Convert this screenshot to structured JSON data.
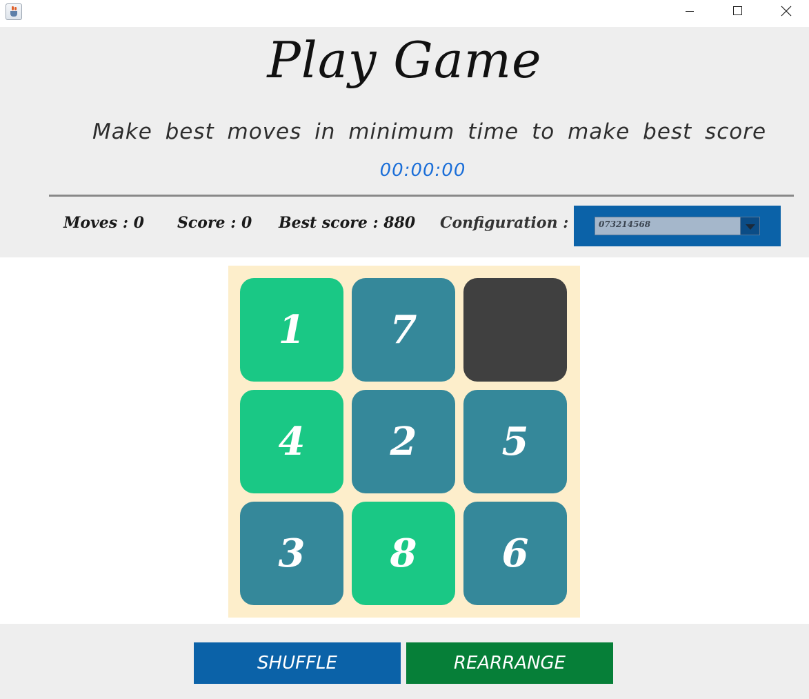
{
  "window": {
    "icon": "java-coffee-cup-icon",
    "controls": [
      "minimize-icon",
      "maximize-icon",
      "close-icon"
    ]
  },
  "header": {
    "title": "Play Game",
    "subtitle": "Make best moves in minimum time to make best score",
    "timer": "00:00:00",
    "moves": "Moves : 0",
    "score": "Score : 0",
    "best_score": "Best score : 880",
    "configuration_label": "Configuration :",
    "configuration_value": "073214568"
  },
  "board": {
    "tiles": [
      {
        "label": "1",
        "color": "#1ac885"
      },
      {
        "label": "7",
        "color": "#35889a"
      },
      {
        "label": "",
        "color": "#404040"
      },
      {
        "label": "4",
        "color": "#1ac885"
      },
      {
        "label": "2",
        "color": "#35889a"
      },
      {
        "label": "5",
        "color": "#35889a"
      },
      {
        "label": "3",
        "color": "#35889a"
      },
      {
        "label": "8",
        "color": "#1ac885"
      },
      {
        "label": "6",
        "color": "#35889a"
      }
    ],
    "background": "#fdeecb"
  },
  "buttons": {
    "shuffle": "SHUFFLE",
    "rearrange": "REARRANGE"
  },
  "colors": {
    "primary_blue": "#0b62a8",
    "action_green": "#067f38",
    "timer_blue": "#1a6ed8"
  }
}
